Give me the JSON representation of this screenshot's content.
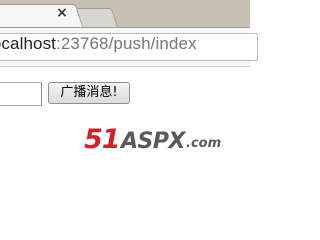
{
  "browser": {
    "tab_close_glyph": "×",
    "address": {
      "host": "localhost",
      "path": ":23768/push/index"
    }
  },
  "page": {
    "message_input_value": "",
    "broadcast_button_label": "广播消息!"
  },
  "watermark": {
    "number": "51",
    "brand": "ASPX",
    "tld": ".com",
    "colors": {
      "number": "#d61f2a",
      "brand": "#5a5a5a"
    }
  }
}
